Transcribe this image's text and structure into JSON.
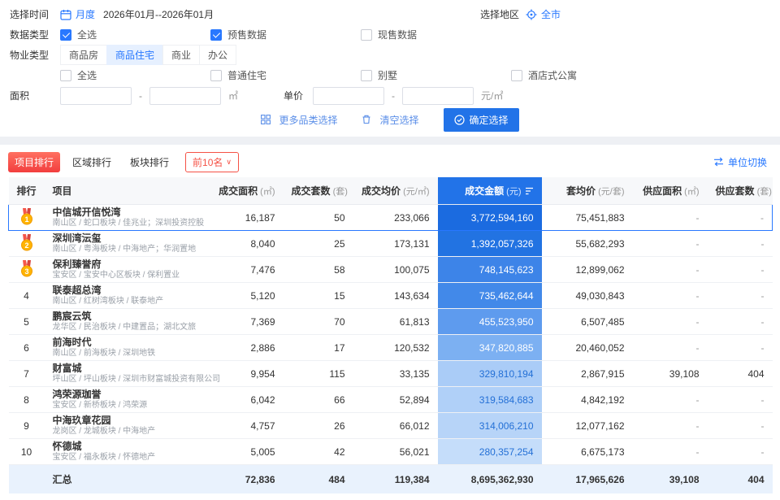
{
  "filters": {
    "time": {
      "label": "选择时间",
      "mode": "月度",
      "range": "2026年01月--2026年01月"
    },
    "region": {
      "label": "选择地区",
      "value": "全市"
    },
    "data_type": {
      "label": "数据类型",
      "options": [
        {
          "name": "select-all",
          "label": "全选",
          "checked": true
        },
        {
          "name": "presale-data",
          "label": "预售数据",
          "checked": true
        },
        {
          "name": "existing-sale-data",
          "label": "现售数据",
          "checked": false
        }
      ]
    },
    "property_type": {
      "label": "物业类型",
      "tabs": [
        {
          "name": "commodity-housing",
          "label": "商品房",
          "selected": false
        },
        {
          "name": "commodity-residential",
          "label": "商品住宅",
          "selected": true
        },
        {
          "name": "commercial",
          "label": "商业",
          "selected": false
        },
        {
          "name": "office",
          "label": "办公",
          "selected": false
        }
      ],
      "sub_options": [
        {
          "name": "sub-select-all",
          "label": "全选",
          "checked": false
        },
        {
          "name": "ordinary-residence",
          "label": "普通住宅",
          "checked": false
        },
        {
          "name": "villa",
          "label": "别墅",
          "checked": false
        },
        {
          "name": "hotel-apartment",
          "label": "酒店式公寓",
          "checked": false
        }
      ]
    },
    "area": {
      "label": "面积",
      "min": "",
      "max": "",
      "unit": "㎡"
    },
    "price": {
      "label": "单价",
      "min": "",
      "max": "",
      "unit": "元/㎡"
    },
    "actions": {
      "more": "更多品类选择",
      "clear": "清空选择",
      "confirm": "确定选择"
    }
  },
  "ranking": {
    "tabs": [
      {
        "name": "project-ranking",
        "label": "项目排行",
        "selected": true
      },
      {
        "name": "region-ranking",
        "label": "区域排行",
        "selected": false
      },
      {
        "name": "sector-ranking",
        "label": "板块排行",
        "selected": false
      }
    ],
    "top_n": "前10名",
    "unit_switch": "单位切换"
  },
  "colors": {
    "accent_blue": "#2273e8",
    "accent_red": "#f23e3e",
    "medal_gold": "#ffb402",
    "medal_ribbon": "#f5564a"
  },
  "table": {
    "headers": [
      {
        "label": "排行",
        "unit": ""
      },
      {
        "label": "项目",
        "unit": ""
      },
      {
        "label": "成交面积",
        "unit": "(㎡)"
      },
      {
        "label": "成交套数",
        "unit": "(套)"
      },
      {
        "label": "成交均价",
        "unit": "(元/㎡)"
      },
      {
        "label": "成交金额",
        "unit": "(元)",
        "highlight": true,
        "sortable": true
      },
      {
        "label": "套均价",
        "unit": "(元/套)"
      },
      {
        "label": "供应面积",
        "unit": "(㎡)"
      },
      {
        "label": "供应套数",
        "unit": "(套)"
      }
    ],
    "rows": [
      {
        "rank": 1,
        "medal": true,
        "selected": true,
        "name": "中信城开信悦湾",
        "detail": "南山区 / 蛇口板块 / 佳兆业；深圳投资控股",
        "area": "16,187",
        "units": "50",
        "avg_price": "233,066",
        "amount": "3,772,594,160",
        "unit_price": "75,451,883",
        "supply_area": "-",
        "supply_units": "-",
        "amount_bg": "#1b6be0",
        "amount_fg": "#ffffff"
      },
      {
        "rank": 2,
        "medal": true,
        "selected": false,
        "name": "深圳湾沄玺",
        "detail": "南山区 / 粤海板块 / 中海地产；华润置地",
        "area": "8,040",
        "units": "25",
        "avg_price": "173,131",
        "amount": "1,392,057,326",
        "unit_price": "55,682,293",
        "supply_area": "-",
        "supply_units": "-",
        "amount_bg": "#2273e2",
        "amount_fg": "#ffffff"
      },
      {
        "rank": 3,
        "medal": true,
        "selected": false,
        "name": "保利臻誉府",
        "detail": "宝安区 / 宝安中心区板块 / 保利置业",
        "area": "7,476",
        "units": "58",
        "avg_price": "100,075",
        "amount": "748,145,623",
        "unit_price": "12,899,062",
        "supply_area": "-",
        "supply_units": "-",
        "amount_bg": "#3d84e8",
        "amount_fg": "#ffffff"
      },
      {
        "rank": 4,
        "medal": false,
        "selected": false,
        "name": "联泰超总湾",
        "detail": "南山区 / 红树湾板块 / 联泰地产",
        "area": "5,120",
        "units": "15",
        "avg_price": "143,634",
        "amount": "735,462,644",
        "unit_price": "49,030,843",
        "supply_area": "-",
        "supply_units": "-",
        "amount_bg": "#4289e9",
        "amount_fg": "#ffffff"
      },
      {
        "rank": 5,
        "medal": false,
        "selected": false,
        "name": "鹏宸云筑",
        "detail": "龙华区 / 民治板块 / 中建置品；湖北文旅",
        "area": "7,369",
        "units": "70",
        "avg_price": "61,813",
        "amount": "455,523,950",
        "unit_price": "6,507,485",
        "supply_area": "-",
        "supply_units": "-",
        "amount_bg": "#5e9bee",
        "amount_fg": "#ffffff"
      },
      {
        "rank": 6,
        "medal": false,
        "selected": false,
        "name": "前海时代",
        "detail": "南山区 / 前海板块 / 深圳地铁",
        "area": "2,886",
        "units": "17",
        "avg_price": "120,532",
        "amount": "347,820,885",
        "unit_price": "20,460,052",
        "supply_area": "-",
        "supply_units": "-",
        "amount_bg": "#7cb0f2",
        "amount_fg": "#ffffff"
      },
      {
        "rank": 7,
        "medal": false,
        "selected": false,
        "name": "财富城",
        "detail": "坪山区 / 坪山板块 / 深圳市财富城投资有限公司",
        "area": "9,954",
        "units": "115",
        "avg_price": "33,135",
        "amount": "329,810,194",
        "unit_price": "2,867,915",
        "supply_area": "39,108",
        "supply_units": "404",
        "amount_bg": "#aaccf7",
        "amount_fg": "#2470d6"
      },
      {
        "rank": 8,
        "medal": false,
        "selected": false,
        "name": "鸿荣源珈誉",
        "detail": "宝安区 / 新桥板块 / 鸿荣源",
        "area": "6,042",
        "units": "66",
        "avg_price": "52,894",
        "amount": "319,584,683",
        "unit_price": "4,842,192",
        "supply_area": "-",
        "supply_units": "-",
        "amount_bg": "#b0d0f8",
        "amount_fg": "#2470d6"
      },
      {
        "rank": 9,
        "medal": false,
        "selected": false,
        "name": "中海玖章花园",
        "detail": "龙岗区 / 龙城板块 / 中海地产",
        "area": "4,757",
        "units": "26",
        "avg_price": "66,012",
        "amount": "314,006,210",
        "unit_price": "12,077,162",
        "supply_area": "-",
        "supply_units": "-",
        "amount_bg": "#b7d4f8",
        "amount_fg": "#2470d6"
      },
      {
        "rank": 10,
        "medal": false,
        "selected": false,
        "name": "怀德城",
        "detail": "宝安区 / 福永板块 / 怀德地产",
        "area": "5,005",
        "units": "42",
        "avg_price": "56,021",
        "amount": "280,357,254",
        "unit_price": "6,675,173",
        "supply_area": "-",
        "supply_units": "-",
        "amount_bg": "#c5ddfa",
        "amount_fg": "#2470d6"
      }
    ],
    "summary": {
      "label": "汇总",
      "area": "72,836",
      "units": "484",
      "avg_price": "119,384",
      "amount": "8,695,362,930",
      "unit_price": "17,965,626",
      "supply_area": "39,108",
      "supply_units": "404"
    }
  }
}
